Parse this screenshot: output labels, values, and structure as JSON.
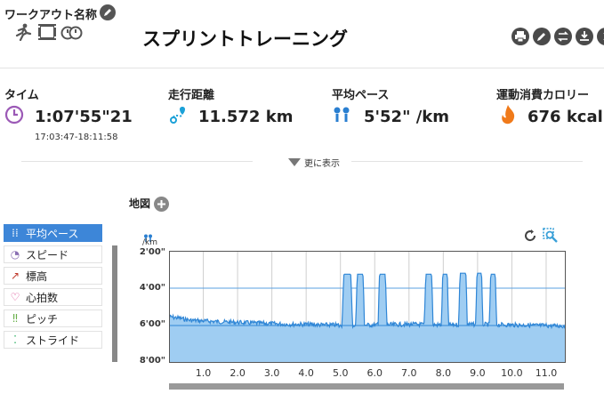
{
  "header": {
    "workout_name_label": "ワークアウト名称",
    "title": "スプリントトレーニング",
    "action_icons": [
      "print-icon",
      "edit-icon",
      "swap-icon",
      "download-icon",
      "more-icon"
    ]
  },
  "metrics": [
    {
      "label": "タイム",
      "value": "1:07'55\"21",
      "sub": "17:03:47-18:11:58",
      "icon": "clock-icon",
      "color": "#9b59b6"
    },
    {
      "label": "走行距離",
      "value": "11.572 km",
      "icon": "route-icon",
      "color": "#1ba1d8"
    },
    {
      "label": "平均ペース",
      "value": "5'52\" /km",
      "icon": "pace-icon",
      "color": "#2a7fd1"
    },
    {
      "label": "運動消費カロリー",
      "value": "676 kcal",
      "icon": "flame-icon",
      "color": "#f07a1a"
    }
  ],
  "more_label": "更に表示",
  "map_label": "地図",
  "sidebar": {
    "items": [
      {
        "label": "平均ペース",
        "icon": "pace-icon",
        "active": true
      },
      {
        "label": "スピード",
        "icon": "speedometer-icon",
        "active": false
      },
      {
        "label": "標高",
        "icon": "elevation-icon",
        "active": false
      },
      {
        "label": "心拍数",
        "icon": "heart-icon",
        "active": false
      },
      {
        "label": "ピッチ",
        "icon": "footsteps-icon",
        "active": false
      },
      {
        "label": "ストライド",
        "icon": "stride-icon",
        "active": false
      }
    ]
  },
  "chart_data": {
    "type": "area",
    "y_unit": "/km",
    "y_ticks": [
      "2'00\"",
      "4'00\"",
      "6'00\"",
      "8'00\""
    ],
    "ylim_seconds_per_km": [
      120,
      480
    ],
    "y_inverted": true,
    "x_ticks": [
      "1.0",
      "2.0",
      "3.0",
      "4.0",
      "5.0",
      "6.0",
      "7.0",
      "8.0",
      "9.0",
      "10.0",
      "11.0"
    ],
    "xlim_km": [
      0,
      11.572
    ],
    "avg_line_pace": "6'00\"",
    "fill_color": "#9fcdf2",
    "line_color": "#2f86d6",
    "base_pace_seconds": [
      [
        0.0,
        332
      ],
      [
        0.3,
        336
      ],
      [
        0.6,
        343
      ],
      [
        1.0,
        345
      ],
      [
        1.5,
        348
      ],
      [
        2.0,
        350
      ],
      [
        2.5,
        352
      ],
      [
        3.0,
        354
      ],
      [
        3.5,
        356
      ],
      [
        4.0,
        356
      ],
      [
        4.5,
        358
      ],
      [
        4.9,
        358
      ]
    ],
    "sprints": [
      {
        "start_km": 5.05,
        "end_km": 5.35,
        "pace_seconds": 195
      },
      {
        "start_km": 5.45,
        "end_km": 5.7,
        "pace_seconds": 195
      },
      {
        "start_km": 6.1,
        "end_km": 6.35,
        "pace_seconds": 195
      },
      {
        "start_km": 7.45,
        "end_km": 7.7,
        "pace_seconds": 195
      },
      {
        "start_km": 7.95,
        "end_km": 8.15,
        "pace_seconds": 195
      },
      {
        "start_km": 8.45,
        "end_km": 8.7,
        "pace_seconds": 192
      },
      {
        "start_km": 8.95,
        "end_km": 9.15,
        "pace_seconds": 192
      },
      {
        "start_km": 9.35,
        "end_km": 9.55,
        "pace_seconds": 195
      }
    ],
    "tail_pace_seconds": [
      [
        5.0,
        360
      ],
      [
        6.0,
        358
      ],
      [
        7.0,
        356
      ],
      [
        8.0,
        358
      ],
      [
        9.0,
        356
      ],
      [
        10.0,
        358
      ],
      [
        11.0,
        360
      ],
      [
        11.572,
        362
      ]
    ]
  }
}
